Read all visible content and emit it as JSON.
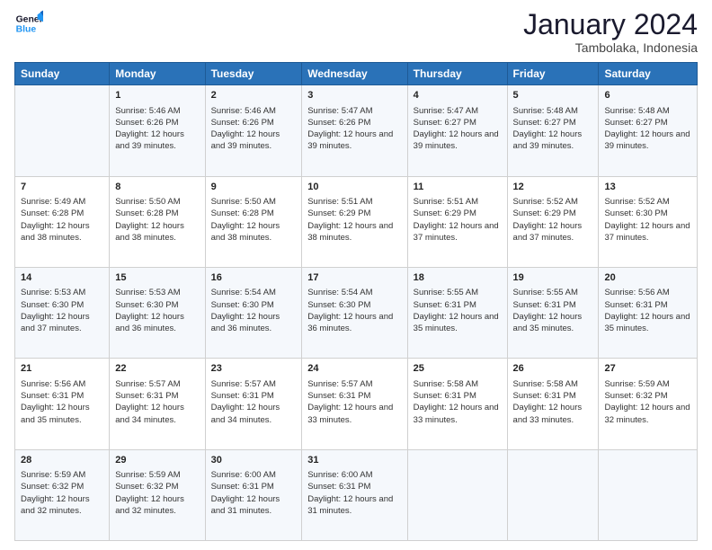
{
  "header": {
    "logo_line1": "General",
    "logo_line2": "Blue",
    "month_title": "January 2024",
    "location": "Tambolaka, Indonesia"
  },
  "days_of_week": [
    "Sunday",
    "Monday",
    "Tuesday",
    "Wednesday",
    "Thursday",
    "Friday",
    "Saturday"
  ],
  "weeks": [
    [
      {
        "day": "",
        "sunrise": "",
        "sunset": "",
        "daylight": ""
      },
      {
        "day": "1",
        "sunrise": "Sunrise: 5:46 AM",
        "sunset": "Sunset: 6:26 PM",
        "daylight": "Daylight: 12 hours and 39 minutes."
      },
      {
        "day": "2",
        "sunrise": "Sunrise: 5:46 AM",
        "sunset": "Sunset: 6:26 PM",
        "daylight": "Daylight: 12 hours and 39 minutes."
      },
      {
        "day": "3",
        "sunrise": "Sunrise: 5:47 AM",
        "sunset": "Sunset: 6:26 PM",
        "daylight": "Daylight: 12 hours and 39 minutes."
      },
      {
        "day": "4",
        "sunrise": "Sunrise: 5:47 AM",
        "sunset": "Sunset: 6:27 PM",
        "daylight": "Daylight: 12 hours and 39 minutes."
      },
      {
        "day": "5",
        "sunrise": "Sunrise: 5:48 AM",
        "sunset": "Sunset: 6:27 PM",
        "daylight": "Daylight: 12 hours and 39 minutes."
      },
      {
        "day": "6",
        "sunrise": "Sunrise: 5:48 AM",
        "sunset": "Sunset: 6:27 PM",
        "daylight": "Daylight: 12 hours and 39 minutes."
      }
    ],
    [
      {
        "day": "7",
        "sunrise": "Sunrise: 5:49 AM",
        "sunset": "Sunset: 6:28 PM",
        "daylight": "Daylight: 12 hours and 38 minutes."
      },
      {
        "day": "8",
        "sunrise": "Sunrise: 5:50 AM",
        "sunset": "Sunset: 6:28 PM",
        "daylight": "Daylight: 12 hours and 38 minutes."
      },
      {
        "day": "9",
        "sunrise": "Sunrise: 5:50 AM",
        "sunset": "Sunset: 6:28 PM",
        "daylight": "Daylight: 12 hours and 38 minutes."
      },
      {
        "day": "10",
        "sunrise": "Sunrise: 5:51 AM",
        "sunset": "Sunset: 6:29 PM",
        "daylight": "Daylight: 12 hours and 38 minutes."
      },
      {
        "day": "11",
        "sunrise": "Sunrise: 5:51 AM",
        "sunset": "Sunset: 6:29 PM",
        "daylight": "Daylight: 12 hours and 37 minutes."
      },
      {
        "day": "12",
        "sunrise": "Sunrise: 5:52 AM",
        "sunset": "Sunset: 6:29 PM",
        "daylight": "Daylight: 12 hours and 37 minutes."
      },
      {
        "day": "13",
        "sunrise": "Sunrise: 5:52 AM",
        "sunset": "Sunset: 6:30 PM",
        "daylight": "Daylight: 12 hours and 37 minutes."
      }
    ],
    [
      {
        "day": "14",
        "sunrise": "Sunrise: 5:53 AM",
        "sunset": "Sunset: 6:30 PM",
        "daylight": "Daylight: 12 hours and 37 minutes."
      },
      {
        "day": "15",
        "sunrise": "Sunrise: 5:53 AM",
        "sunset": "Sunset: 6:30 PM",
        "daylight": "Daylight: 12 hours and 36 minutes."
      },
      {
        "day": "16",
        "sunrise": "Sunrise: 5:54 AM",
        "sunset": "Sunset: 6:30 PM",
        "daylight": "Daylight: 12 hours and 36 minutes."
      },
      {
        "day": "17",
        "sunrise": "Sunrise: 5:54 AM",
        "sunset": "Sunset: 6:30 PM",
        "daylight": "Daylight: 12 hours and 36 minutes."
      },
      {
        "day": "18",
        "sunrise": "Sunrise: 5:55 AM",
        "sunset": "Sunset: 6:31 PM",
        "daylight": "Daylight: 12 hours and 35 minutes."
      },
      {
        "day": "19",
        "sunrise": "Sunrise: 5:55 AM",
        "sunset": "Sunset: 6:31 PM",
        "daylight": "Daylight: 12 hours and 35 minutes."
      },
      {
        "day": "20",
        "sunrise": "Sunrise: 5:56 AM",
        "sunset": "Sunset: 6:31 PM",
        "daylight": "Daylight: 12 hours and 35 minutes."
      }
    ],
    [
      {
        "day": "21",
        "sunrise": "Sunrise: 5:56 AM",
        "sunset": "Sunset: 6:31 PM",
        "daylight": "Daylight: 12 hours and 35 minutes."
      },
      {
        "day": "22",
        "sunrise": "Sunrise: 5:57 AM",
        "sunset": "Sunset: 6:31 PM",
        "daylight": "Daylight: 12 hours and 34 minutes."
      },
      {
        "day": "23",
        "sunrise": "Sunrise: 5:57 AM",
        "sunset": "Sunset: 6:31 PM",
        "daylight": "Daylight: 12 hours and 34 minutes."
      },
      {
        "day": "24",
        "sunrise": "Sunrise: 5:57 AM",
        "sunset": "Sunset: 6:31 PM",
        "daylight": "Daylight: 12 hours and 33 minutes."
      },
      {
        "day": "25",
        "sunrise": "Sunrise: 5:58 AM",
        "sunset": "Sunset: 6:31 PM",
        "daylight": "Daylight: 12 hours and 33 minutes."
      },
      {
        "day": "26",
        "sunrise": "Sunrise: 5:58 AM",
        "sunset": "Sunset: 6:31 PM",
        "daylight": "Daylight: 12 hours and 33 minutes."
      },
      {
        "day": "27",
        "sunrise": "Sunrise: 5:59 AM",
        "sunset": "Sunset: 6:32 PM",
        "daylight": "Daylight: 12 hours and 32 minutes."
      }
    ],
    [
      {
        "day": "28",
        "sunrise": "Sunrise: 5:59 AM",
        "sunset": "Sunset: 6:32 PM",
        "daylight": "Daylight: 12 hours and 32 minutes."
      },
      {
        "day": "29",
        "sunrise": "Sunrise: 5:59 AM",
        "sunset": "Sunset: 6:32 PM",
        "daylight": "Daylight: 12 hours and 32 minutes."
      },
      {
        "day": "30",
        "sunrise": "Sunrise: 6:00 AM",
        "sunset": "Sunset: 6:31 PM",
        "daylight": "Daylight: 12 hours and 31 minutes."
      },
      {
        "day": "31",
        "sunrise": "Sunrise: 6:00 AM",
        "sunset": "Sunset: 6:31 PM",
        "daylight": "Daylight: 12 hours and 31 minutes."
      },
      {
        "day": "",
        "sunrise": "",
        "sunset": "",
        "daylight": ""
      },
      {
        "day": "",
        "sunrise": "",
        "sunset": "",
        "daylight": ""
      },
      {
        "day": "",
        "sunrise": "",
        "sunset": "",
        "daylight": ""
      }
    ]
  ]
}
